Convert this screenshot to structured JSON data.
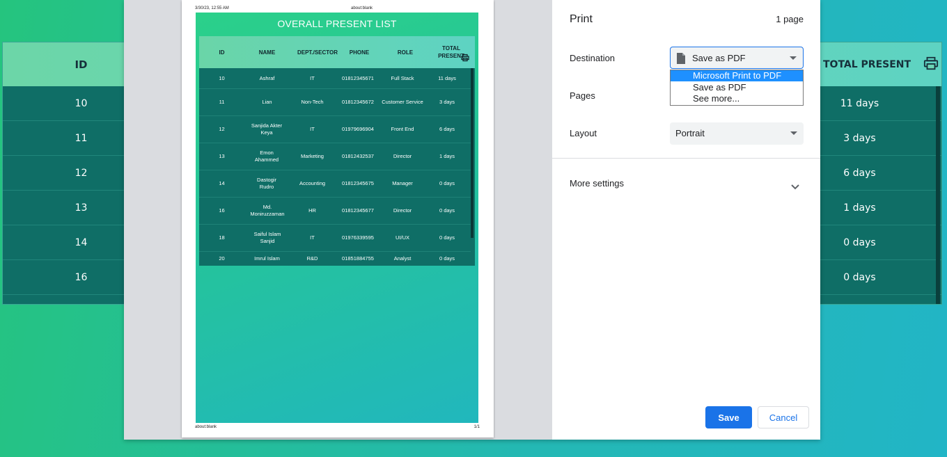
{
  "background": {
    "headers": {
      "id": "ID",
      "total_present": "TOTAL PRESENT"
    },
    "rows": [
      {
        "id": "10",
        "total": "11 days"
      },
      {
        "id": "11",
        "total": "3 days"
      },
      {
        "id": "12",
        "total": "6 days"
      },
      {
        "id": "13",
        "total": "1 days"
      },
      {
        "id": "14",
        "total": "0 days"
      },
      {
        "id": "16",
        "total": "0 days"
      }
    ]
  },
  "preview": {
    "header_left": "3/30/23, 12:55 AM",
    "header_center": "about:blank",
    "footer_left": "about:blank",
    "footer_right": "1/1",
    "title": "OVERALL PRESENT LIST",
    "columns": [
      "ID",
      "NAME",
      "DEPT./SECTOR",
      "PHONE",
      "ROLE",
      "TOTAL PRESENT"
    ],
    "rows": [
      {
        "id": "10",
        "name": "Ashraf",
        "dept": "IT",
        "phone": "01812345671",
        "role": "Full Stack",
        "total": "11 days"
      },
      {
        "id": "11",
        "name": "Lian",
        "dept": "Non-Tech",
        "phone": "01812345672",
        "role": "Customer Service",
        "total": "3 days"
      },
      {
        "id": "12",
        "name": "Sanjida Akter Keya",
        "dept": "IT",
        "phone": "01979696904",
        "role": "Front End",
        "total": "6 days"
      },
      {
        "id": "13",
        "name": "Emon Ahammed",
        "dept": "Marketing",
        "phone": "01812432537",
        "role": "Director",
        "total": "1 days"
      },
      {
        "id": "14",
        "name": "Dastogir Rudro",
        "dept": "Accounting",
        "phone": "01812345675",
        "role": "Manager",
        "total": "0 days"
      },
      {
        "id": "16",
        "name": "Md. Moniruzzaman",
        "dept": "HR",
        "phone": "01812345677",
        "role": "Director",
        "total": "0 days"
      },
      {
        "id": "18",
        "name": "Saiful Islam Sanjid",
        "dept": "IT",
        "phone": "01976339595",
        "role": "UI/UX",
        "total": "0 days"
      },
      {
        "id": "20",
        "name": "Imrul Islam",
        "dept": "R&D",
        "phone": "01851884755",
        "role": "Analyst",
        "total": "0 days"
      }
    ]
  },
  "settings": {
    "title": "Print",
    "page_count": "1 page",
    "destination_label": "Destination",
    "destination_value": "Save as PDF",
    "destination_options": [
      "Microsoft Print to PDF",
      "Save as PDF",
      "See more..."
    ],
    "pages_label": "Pages",
    "layout_label": "Layout",
    "layout_value": "Portrait",
    "more_settings": "More settings",
    "save_label": "Save",
    "cancel_label": "Cancel"
  },
  "colors": {
    "accent": "#1a73e8",
    "dropdown_highlight": "#1e90ff",
    "table_body": "#0f6e66"
  }
}
